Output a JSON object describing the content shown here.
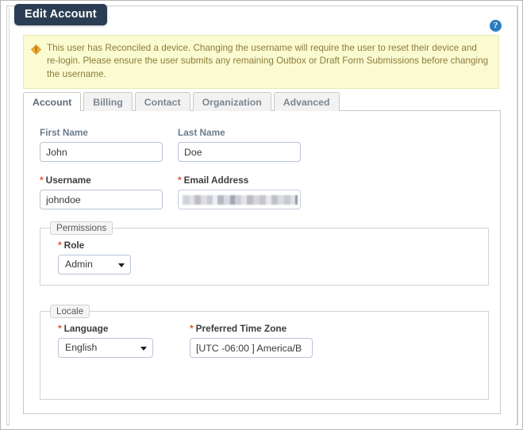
{
  "window": {
    "title": "Edit Account",
    "help_icon": "question-mark-circle-icon"
  },
  "warning": {
    "icon": "warning-diamond-icon",
    "text": "This user has Reconciled a device. Changing the username will require the user to reset their device and re-login. Please ensure the user submits any remaining Outbox or Draft Form Submissions before changing the username.",
    "background_color": "#fbfbd2",
    "border_color": "#e8e8b5",
    "text_color": "#8d7b3a",
    "icon_color": "#f0a628"
  },
  "tabs": [
    {
      "label": "Account",
      "active": true
    },
    {
      "label": "Billing",
      "active": false
    },
    {
      "label": "Contact",
      "active": false
    },
    {
      "label": "Organization",
      "active": false
    },
    {
      "label": "Advanced",
      "active": false
    }
  ],
  "form": {
    "first_name": {
      "label": "First Name",
      "required": false,
      "value": "John",
      "placeholder": ""
    },
    "last_name": {
      "label": "Last Name",
      "required": false,
      "value": "Doe",
      "placeholder": ""
    },
    "username": {
      "label": "Username",
      "required": true,
      "required_marker": "*",
      "value": "johndoe",
      "placeholder": ""
    },
    "email": {
      "label": "Email Address",
      "required": true,
      "required_marker": "*",
      "value": "",
      "redacted": true,
      "placeholder": ""
    }
  },
  "permissions": {
    "legend": "Permissions",
    "role": {
      "label": "Role",
      "required": true,
      "required_marker": "*",
      "selected": "Admin",
      "caret_icon": "chevron-down-icon"
    }
  },
  "locale": {
    "legend": "Locale",
    "language": {
      "label": "Language",
      "required": true,
      "required_marker": "*",
      "selected": "English",
      "caret_icon": "chevron-down-icon"
    },
    "time_zone": {
      "label": "Preferred Time Zone",
      "required": true,
      "required_marker": "*",
      "value": "[UTC -06:00 ] America/B",
      "placeholder": ""
    }
  },
  "theme": {
    "title_badge_bg": "#2b3d52",
    "help_icon_bg": "#2e7cc0",
    "required_star_color": "#e8542a",
    "label_color": "#6b7c8d",
    "input_border_color": "#b9c4d6",
    "tab_border_color": "#c8c8c8",
    "fieldset_border_color": "#d3d3d3"
  }
}
